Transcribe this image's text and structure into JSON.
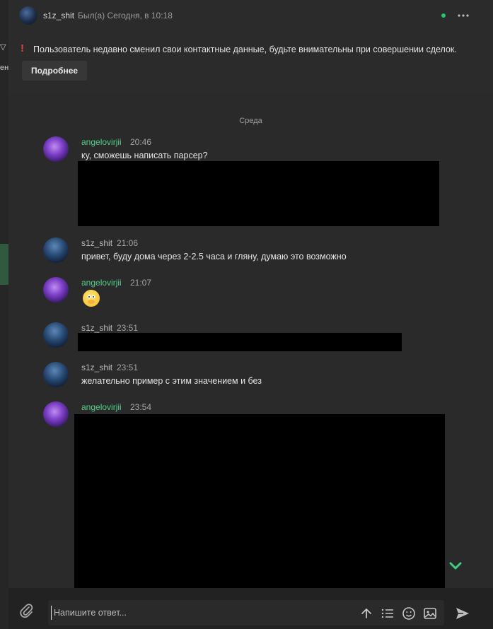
{
  "sidebar_fragments": {
    "top": "▽",
    "mid": "ен"
  },
  "header": {
    "username": "s1z_shit",
    "status": "Был(а) Сегодня, в 10:18",
    "more_icon": "more-dots-icon",
    "online_color": "#25c36a"
  },
  "warning": {
    "icon": "!",
    "text": "Пользователь недавно сменил свои контактные данные, будьте внимательны при совершении сделок.",
    "button": "Подробнее"
  },
  "day_separator": "Среда",
  "messages": [
    {
      "author": "angelovirjii",
      "time": "20:46",
      "text": "ку, сможешь написать парсер?",
      "avatar": "purple"
    },
    {
      "author": "s1z_shit",
      "time": "21:06",
      "text": "привет, буду дома через 2-2.5 часа и гляну, думаю это возможно",
      "avatar": "blue"
    },
    {
      "author": "angelovirjii",
      "time": "21:07",
      "text": "",
      "emoji": "hand-over-mouth-emoji",
      "avatar": "purple"
    },
    {
      "author": "s1z_shit",
      "time": "23:51",
      "text": "",
      "avatar": "blue"
    },
    {
      "author": "s1z_shit",
      "time": "23:51",
      "text": "желательно пример с этим значением и без",
      "avatar": "blue"
    },
    {
      "author": "angelovirjii",
      "time": "23:54",
      "text": "",
      "avatar": "purple"
    }
  ],
  "composer": {
    "placeholder": "Напишите ответ..."
  },
  "colors": {
    "accent_green": "#4fcf88",
    "warning_red": "#e0453a"
  }
}
